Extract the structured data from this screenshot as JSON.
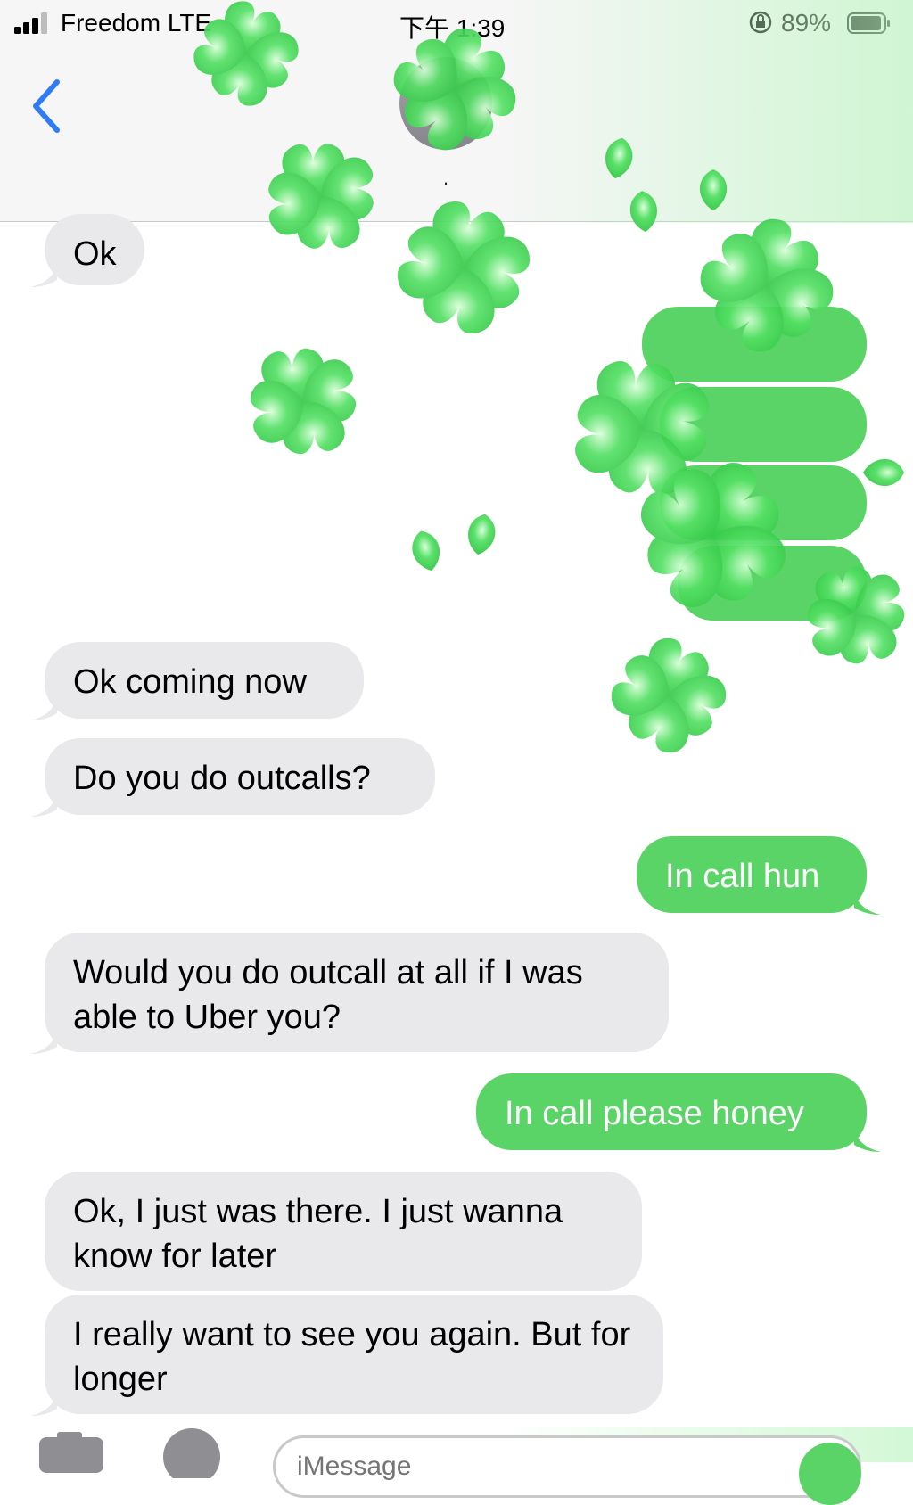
{
  "status_bar": {
    "carrier": "Freedom  LTE",
    "time": "下午 1:39",
    "battery": "89%"
  },
  "header": {
    "contact_name": "·",
    "back_icon": "chevron-left-icon"
  },
  "messages": [
    {
      "direction": "incoming",
      "text": "Ok"
    },
    {
      "direction": "incoming",
      "text": "Ok coming now"
    },
    {
      "direction": "incoming",
      "text": "Do you do outcalls?"
    },
    {
      "direction": "outgoing",
      "text": "In call hun"
    },
    {
      "direction": "incoming",
      "text": "Would you do outcall at all if I was able to Uber you?"
    },
    {
      "direction": "outgoing",
      "text": "In call please honey"
    },
    {
      "direction": "incoming",
      "text": "Ok, I just was there. I just wanna know for later"
    },
    {
      "direction": "incoming",
      "text": "I really want to see you again. But for longer"
    }
  ],
  "composer": {
    "placeholder": "iMessage",
    "camera_icon": "camera-icon",
    "appstore_icon": "app-store-icon"
  },
  "colors": {
    "outgoing_bubble": "#5bd467",
    "incoming_bubble": "#e9e9eb",
    "accent_blue": "#2f7cf6",
    "clover_green": "#3fe055"
  },
  "effect": "clover-screen-effect"
}
